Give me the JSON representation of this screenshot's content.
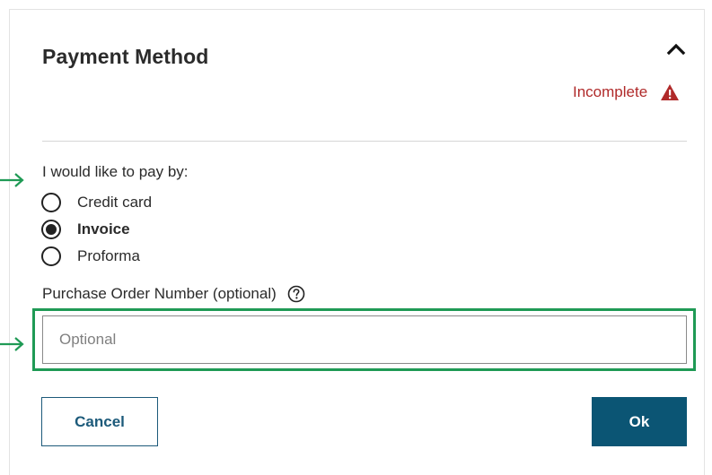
{
  "section": {
    "title": "Payment Method",
    "collapse_icon": "chevron-up-icon",
    "status": {
      "text": "Incomplete",
      "icon": "warning-icon",
      "color": "#b02a2a"
    }
  },
  "payment": {
    "prompt": "I would like to pay by:",
    "options": [
      {
        "label": "Credit card",
        "selected": false
      },
      {
        "label": "Invoice",
        "selected": true
      },
      {
        "label": "Proforma",
        "selected": false
      }
    ]
  },
  "purchase_order": {
    "label": "Purchase Order Number (optional)",
    "help_icon": "question-circle-icon",
    "placeholder": "Optional",
    "value": ""
  },
  "actions": {
    "cancel_label": "Cancel",
    "ok_label": "Ok"
  },
  "annotations": {
    "arrow_icon": "arrow-right-icon",
    "highlight_color": "#1f9a55"
  },
  "colors": {
    "primary": "#0b5574",
    "cancel_border": "#1c5a7a",
    "warning": "#b02a2a"
  }
}
